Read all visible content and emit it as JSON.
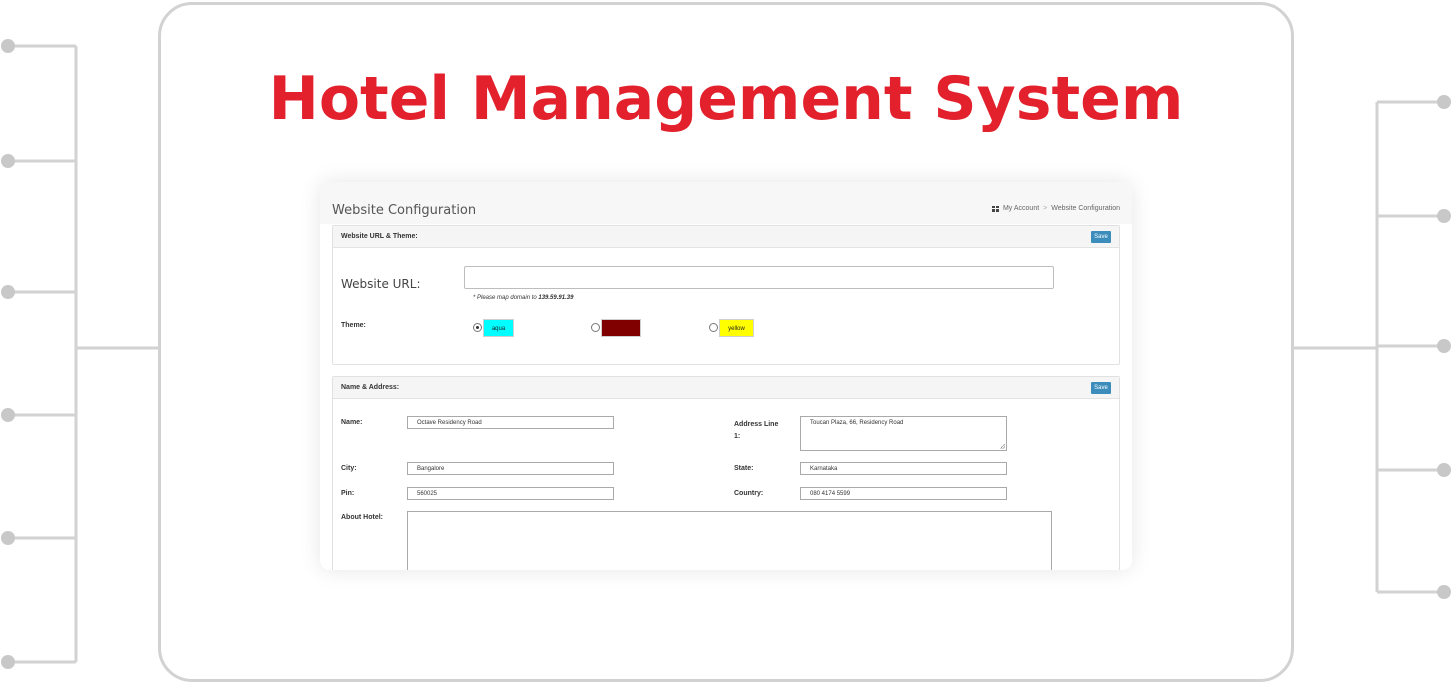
{
  "hero": {
    "title": "Hotel Management System"
  },
  "colors": {
    "accent": "#e2212d",
    "frame": "#d2d2d2",
    "save_button": "#3c8dbc"
  },
  "screenshot": {
    "page_title": "Website Configuration",
    "breadcrumb": {
      "icon": "grid-icon",
      "items": [
        "My Account",
        "Website Configuration"
      ],
      "separator": ">"
    },
    "url_theme_panel": {
      "title": "Website URL & Theme:",
      "save_label": "Save",
      "url_label": "Website URL:",
      "url_value": "",
      "hint_prefix": "* Please map domain to ",
      "hint_ip": "139.59.91.39",
      "theme_label": "Theme:",
      "themes": [
        {
          "label": "aqua",
          "color": "#00ffff",
          "selected": true
        },
        {
          "label": "maroon",
          "color": "#800000",
          "selected": false
        },
        {
          "label": "yellow",
          "color": "#ffff00",
          "selected": false
        }
      ]
    },
    "name_address_panel": {
      "title": "Name & Address:",
      "save_label": "Save",
      "name_label": "Name:",
      "name_value": "Octave Residency Road",
      "address_label": "Address Line 1:",
      "address_value": "Toucan Plaza, 66, Residency Road",
      "city_label": "City:",
      "city_value": "Bangalore",
      "state_label": "State:",
      "state_value": "Karnataka",
      "pin_label": "Pin:",
      "pin_value": "560025",
      "country_label": "Country:",
      "country_value": "080 4174 5599",
      "about_label": "About Hotel:",
      "about_value": ""
    }
  }
}
